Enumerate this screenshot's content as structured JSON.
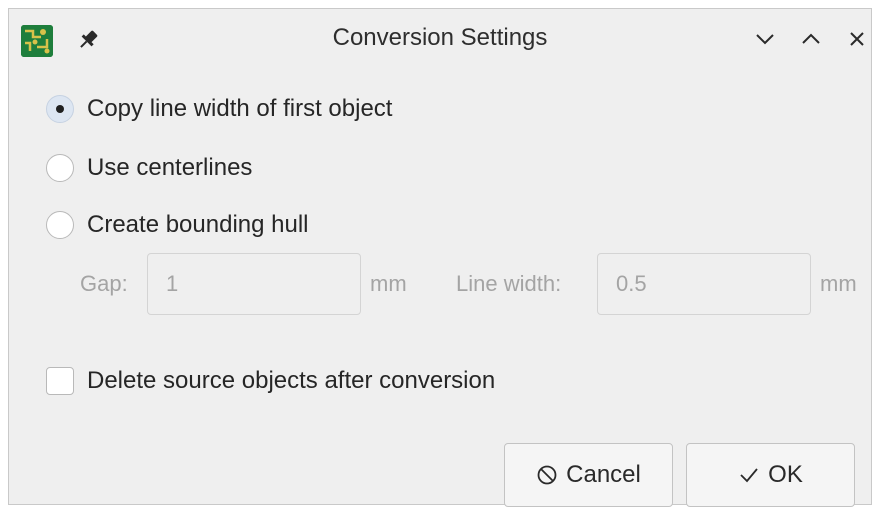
{
  "window": {
    "title": "Conversion Settings",
    "app_icon": "pcb-icon",
    "pin_icon": "pin-icon",
    "controls": [
      "minimize-icon",
      "maximize-icon",
      "close-icon"
    ]
  },
  "options": {
    "copy_line_width": {
      "label": "Copy line width of first object",
      "selected": true
    },
    "use_centerlines": {
      "label": "Use centerlines",
      "selected": false
    },
    "bounding_hull": {
      "label": "Create bounding hull",
      "selected": false
    }
  },
  "hull": {
    "gap_label": "Gap:",
    "gap_value": "1",
    "gap_unit": "mm",
    "line_width_label": "Line width:",
    "line_width_value": "0.5",
    "line_width_unit": "mm"
  },
  "delete_source": {
    "label": "Delete source objects after conversion",
    "checked": false
  },
  "buttons": {
    "cancel": "Cancel",
    "ok": "OK"
  },
  "colors": {
    "window_bg": "#efefef",
    "radio_selected_bg": "#dde6f2",
    "disabled_text": "#a4a4a4",
    "app_icon_green": "#1e7e3c"
  }
}
